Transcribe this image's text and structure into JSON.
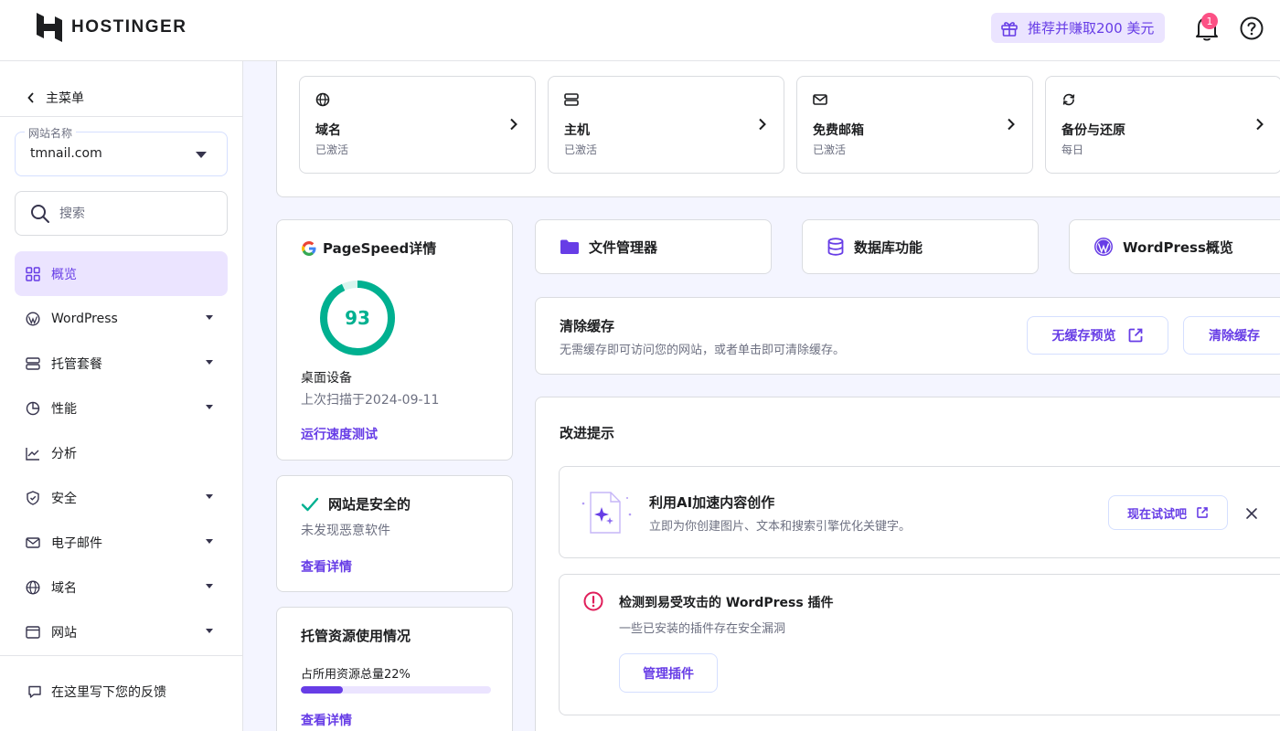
{
  "brand": {
    "name": "HOSTINGER",
    "accent": "#673de6",
    "success": "#00b090",
    "danger": "#fc5185"
  },
  "header": {
    "referral_label": "推荐并赚取200 美元",
    "notification_count": "1",
    "icons": [
      "gift-icon",
      "bell-icon",
      "help-icon"
    ]
  },
  "sidebar": {
    "back_label": "主菜单",
    "site_select": {
      "legend": "网站名称",
      "value": "tmnail.com"
    },
    "search": {
      "placeholder": "搜索"
    },
    "items": [
      {
        "label": "概览",
        "icon": "grid-icon",
        "active": true,
        "expandable": false
      },
      {
        "label": "WordPress",
        "icon": "wordpress-icon",
        "active": false,
        "expandable": true
      },
      {
        "label": "托管套餐",
        "icon": "server-icon",
        "active": false,
        "expandable": true
      },
      {
        "label": "性能",
        "icon": "pie-chart-icon",
        "active": false,
        "expandable": true
      },
      {
        "label": "分析",
        "icon": "trend-icon",
        "active": false,
        "expandable": false
      },
      {
        "label": "安全",
        "icon": "shield-icon",
        "active": false,
        "expandable": true
      },
      {
        "label": "电子邮件",
        "icon": "mail-icon",
        "active": false,
        "expandable": true
      },
      {
        "label": "域名",
        "icon": "globe-icon",
        "active": false,
        "expandable": true
      },
      {
        "label": "网站",
        "icon": "browser-icon",
        "active": false,
        "expandable": true
      }
    ],
    "feedback_label": "在这里写下您的反馈"
  },
  "quick_cards": [
    {
      "title": "域名",
      "status": "已激活",
      "icon": "globe-icon"
    },
    {
      "title": "主机",
      "status": "已激活",
      "icon": "server-icon"
    },
    {
      "title": "免费邮箱",
      "status": "已激活",
      "icon": "mail-icon"
    },
    {
      "title": "备份与还原",
      "status": "每日",
      "icon": "sync-icon"
    }
  ],
  "pagespeed": {
    "title": "PageSpeed详情",
    "score": 93,
    "device": "桌面设备",
    "last_scan": "上次扫描于2024-09-11",
    "link": "运行速度测试"
  },
  "security": {
    "title": "网站是安全的",
    "subtitle": "未发现恶意软件",
    "link": "查看详情"
  },
  "usage": {
    "title": "托管资源使用情况",
    "label": "占所用资源总量22%",
    "percent": 22,
    "link": "查看详情"
  },
  "tools": [
    {
      "label": "文件管理器",
      "icon": "folder-icon"
    },
    {
      "label": "数据库功能",
      "icon": "database-icon"
    },
    {
      "label": "WordPress概览",
      "icon": "wordpress-icon"
    }
  ],
  "cache": {
    "title": "清除缓存",
    "subtitle": "无需缓存即可访问您的网站，或者单击即可清除缓存。",
    "preview_button": "无缓存预览",
    "clear_button": "清除缓存"
  },
  "tips": {
    "title": "改进提示",
    "ai": {
      "title": "利用AI加速内容创作",
      "subtitle": "立即为你创建图片、文本和搜索引擎优化关键字。",
      "button": "现在试试吧"
    },
    "warning": {
      "title": "检测到易受攻击的 WordPress 插件",
      "subtitle": "一些已安装的插件存在安全漏洞",
      "button": "管理插件"
    }
  }
}
